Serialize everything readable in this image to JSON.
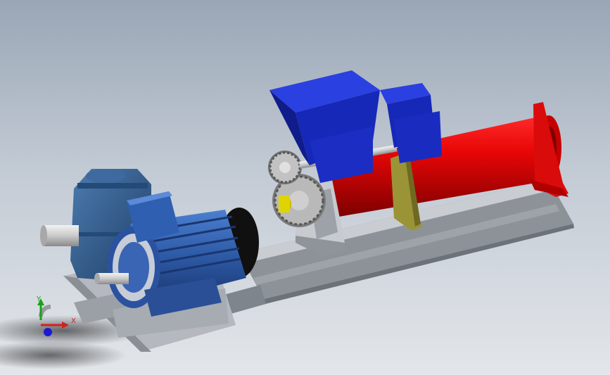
{
  "viewport": {
    "background_top": "#9aa6b6",
    "background_bottom": "#e3e6ea"
  },
  "model": {
    "motor_color": "#2d5aa5",
    "gearbox_color": "#2f5a8c",
    "hopper_color": "#1f33c9",
    "barrel_color": "#e0060a",
    "frame_color": "#a9adb4",
    "gear_color": "#b9b9b9",
    "bracket_color": "#9a9436"
  },
  "triad": {
    "x_label": "X",
    "y_label": "Y",
    "x_color": "#d32020",
    "y_color": "#1aa01a",
    "z_color": "#1a1ad0"
  }
}
